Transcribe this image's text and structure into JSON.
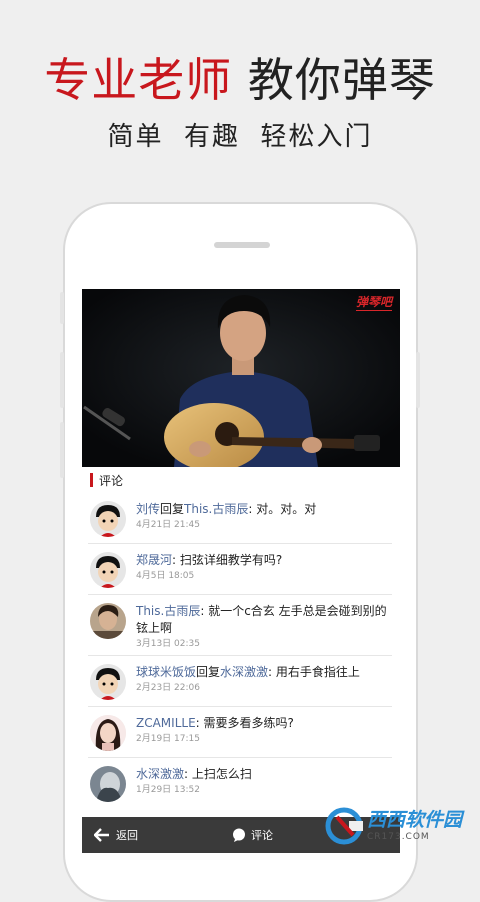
{
  "promo": {
    "headline_red": "专业老师",
    "headline_dark": "教你弹琴",
    "subline": "简单  有趣  轻松入门"
  },
  "video": {
    "brand_logo": "弹琴吧"
  },
  "comments_section": {
    "title": "评论",
    "items": [
      {
        "name": "刘传",
        "reply_text": "回复",
        "reply_to": "This.古雨辰",
        "text": ": 对。对。对",
        "time": "4月21日 21:45",
        "avatar": "cartoon-avatar"
      },
      {
        "name": "郑晟河",
        "reply_text": "",
        "reply_to": "",
        "text": ": 扫弦详细教学有吗?",
        "time": "4月5日 18:05",
        "avatar": "cartoon-avatar"
      },
      {
        "name": "This.古雨辰",
        "reply_text": "",
        "reply_to": "",
        "text": ": 就一个c合玄 左手总是会碰到别的铉上啊",
        "time": "3月13日 02:35",
        "avatar": "photo-avatar"
      },
      {
        "name": "球球米饭饭",
        "reply_text": "回复",
        "reply_to": "水深激激",
        "text": ": 用右手食指往上",
        "time": "2月23日 22:06",
        "avatar": "cartoon-avatar"
      },
      {
        "name": "ZCAMILLE",
        "reply_text": "",
        "reply_to": "",
        "text": ": 需要多看多练吗?",
        "time": "2月19日 17:15",
        "avatar": "girl-avatar"
      },
      {
        "name": "水深激激",
        "reply_text": "",
        "reply_to": "",
        "text": ": 上扫怎么扫",
        "time": "1月29日 13:52",
        "avatar": "photo-avatar"
      }
    ]
  },
  "bottom_bar": {
    "back_label": "返回",
    "comment_label": "评论"
  },
  "watermark": {
    "big": "西西软件园",
    "small": "CR173.COM"
  },
  "colors": {
    "accent_red": "#c8171d",
    "name_blue": "#4f6a9a"
  }
}
